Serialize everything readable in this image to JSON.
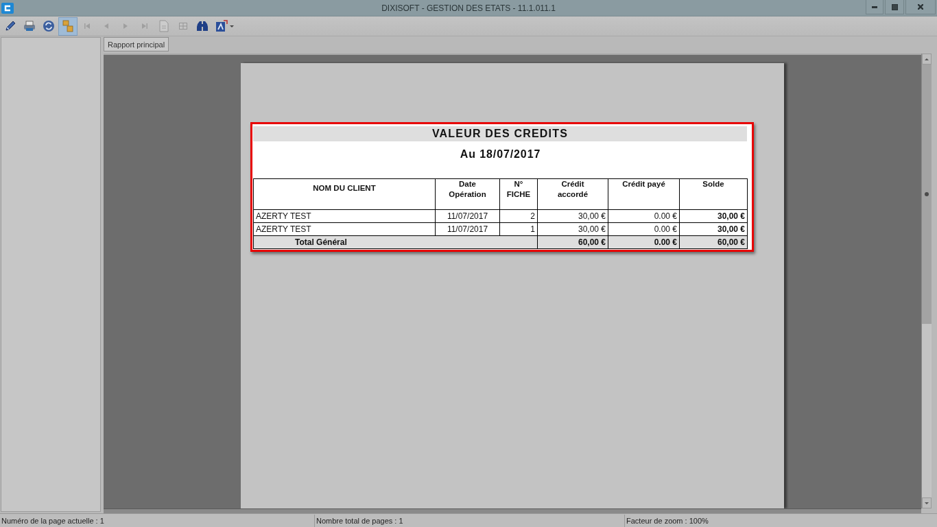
{
  "window": {
    "title": "DIXISOFT - GESTION DES ETATS - 11.1.011.1"
  },
  "toolbar": {
    "buttons": [
      {
        "kind": "pencil",
        "selected": false,
        "disabled": false
      },
      {
        "kind": "printer",
        "selected": false,
        "disabled": false
      },
      {
        "kind": "refresh",
        "selected": false,
        "disabled": false
      },
      {
        "kind": "documents",
        "selected": true,
        "disabled": false
      },
      {
        "kind": "first",
        "selected": false,
        "disabled": true
      },
      {
        "kind": "previous",
        "selected": false,
        "disabled": true
      },
      {
        "kind": "next",
        "selected": false,
        "disabled": true
      },
      {
        "kind": "last",
        "selected": false,
        "disabled": true
      },
      {
        "kind": "page",
        "selected": false,
        "disabled": true
      },
      {
        "kind": "grid",
        "selected": false,
        "disabled": true
      },
      {
        "kind": "binoculars",
        "selected": false,
        "disabled": false
      },
      {
        "kind": "export",
        "selected": false,
        "disabled": false,
        "dropdown": true
      }
    ]
  },
  "tabs": [
    {
      "label": "Rapport principal",
      "selected": true
    }
  ],
  "report": {
    "highlighted": true,
    "title": "VALEUR DES CREDITS",
    "date": "Au 18/07/2017",
    "table": {
      "columns": [
        "NOM DU CLIENT",
        "Date\nOpération",
        "N°\nFICHE",
        "Crédit\naccordé",
        "Crédit payé",
        "Solde"
      ],
      "rows": [
        {
          "cells": [
            "AZERTY TEST",
            "11/07/2017",
            "2",
            "30,00 €",
            "0.00 €",
            "30,00 €"
          ]
        },
        {
          "cells": [
            "AZERTY TEST",
            "11/07/2017",
            "1",
            "30,00 €",
            "0.00 €",
            "30,00 €"
          ]
        }
      ],
      "total": {
        "label": "Total Général",
        "values": [
          "60,00 €",
          "0.00 €",
          "60,00 €"
        ]
      }
    }
  },
  "status_bar": [
    "Numéro de la page actuelle : 1",
    "Nombre total de pages : 1",
    "Facteur de zoom : 100%"
  ]
}
